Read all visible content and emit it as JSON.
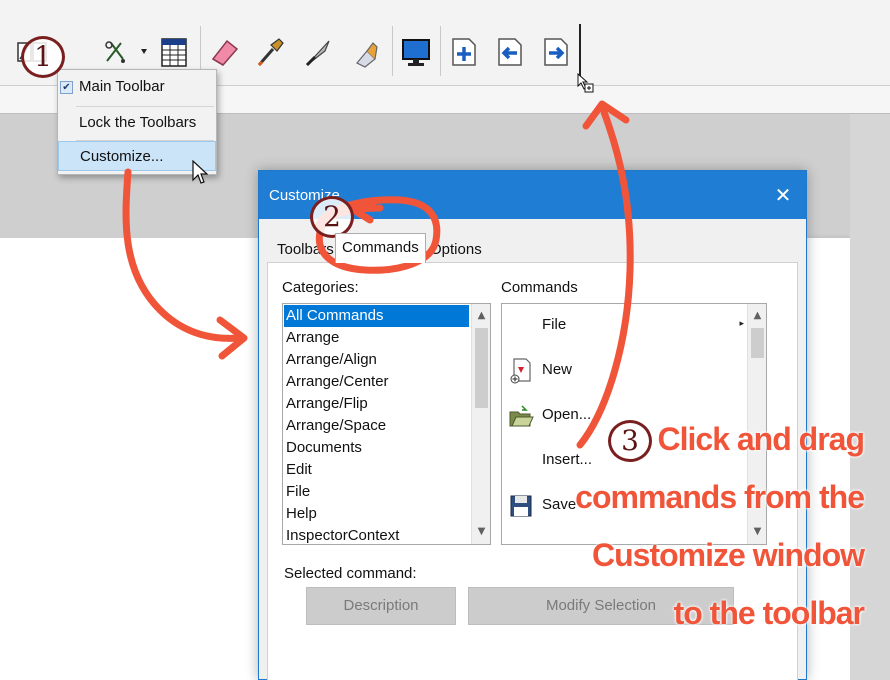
{
  "menu": {
    "items": [
      {
        "label": "Main Toolbar",
        "checked": true
      },
      {
        "label": "Lock the Toolbars",
        "checked": false
      },
      {
        "label": "Customize...",
        "checked": false,
        "highlighted": true
      }
    ]
  },
  "dialog": {
    "title": "Customize",
    "close_glyph": "✕",
    "tabs": [
      {
        "label": "Toolbars",
        "active": false
      },
      {
        "label": "Commands",
        "active": true
      },
      {
        "label": "Options",
        "active": false
      }
    ],
    "categories_label": "Categories:",
    "categories": [
      "All Commands",
      "Arrange",
      "Arrange/Align",
      "Arrange/Center",
      "Arrange/Flip",
      "Arrange/Space",
      "Documents",
      "Edit",
      "File",
      "Help",
      "InspectorContext"
    ],
    "selected_category": "All Commands",
    "commands_label": "Commands",
    "commands": [
      {
        "label": "File",
        "icon": "none",
        "has_submenu": true,
        "submenu_glyph": "▸"
      },
      {
        "label": "New",
        "icon": "new-document-icon",
        "has_submenu": false
      },
      {
        "label": "Open...",
        "icon": "open-folder-icon",
        "has_submenu": false
      },
      {
        "label": "Insert...",
        "icon": "none",
        "has_submenu": false
      },
      {
        "label": "Save",
        "icon": "floppy-disk-icon",
        "has_submenu": false
      }
    ],
    "selected_command_label": "Selected command:",
    "description_button": "Description",
    "modify_selection_button": "Modify Selection"
  },
  "annotations": {
    "step1": "1",
    "step2": "2",
    "step3": "3",
    "callout_lines": [
      "Click and drag",
      "commands from the",
      "Customize window",
      "to the toolbar"
    ],
    "accent_color": "#f0553a",
    "badge_color": "#7a1f1f"
  },
  "toolbar_icons": [
    "graph-number-icon",
    "transform-dropdown-icon",
    "table-icon",
    "eraser-icon",
    "eyedropper-icon",
    "knife-icon",
    "glue-bottle-icon",
    "monitor-icon",
    "add-page-icon",
    "previous-page-icon",
    "next-page-icon"
  ],
  "colors": {
    "title_bar": "#1f7ed4",
    "selection": "#0078d7",
    "menu_highlight": "#cce4f7"
  }
}
